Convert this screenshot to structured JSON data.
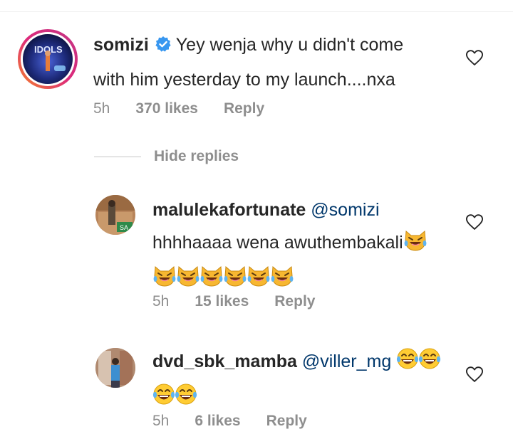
{
  "comments": [
    {
      "username": "somizi",
      "verified": true,
      "text_line1": "Yey wenja why u didn't come",
      "text_line2": "with him yesterday to my launch....nxa",
      "time": "5h",
      "likes": "370 likes",
      "reply": "Reply",
      "avatar_icon": "profile-photo-with-story-ring"
    }
  ],
  "hide_replies": "Hide replies",
  "replies": [
    {
      "username": "malulekafortunate",
      "mention": "@somizi",
      "text_line1": "hhhhaaaa wena awuthembakali",
      "emoji": "tears-of-joy-cat-face",
      "emoji_count_line1": 1,
      "emoji_count_line2": 6,
      "time": "5h",
      "likes": "15 likes",
      "reply": "Reply"
    },
    {
      "username": "dvd_sbk_mamba",
      "mention": "@viller_mg",
      "emoji": "face-with-tears-of-joy",
      "emoji_count_line1": 2,
      "emoji_count_line2": 2,
      "time": "5h",
      "likes": "6 likes",
      "reply": "Reply"
    }
  ],
  "colors": {
    "text": "#262626",
    "meta": "#8e8e8e",
    "mention": "#00376b",
    "verified": "#3897f0",
    "story_ring_start": "#f58529",
    "story_ring_end": "#dd2a7b"
  }
}
